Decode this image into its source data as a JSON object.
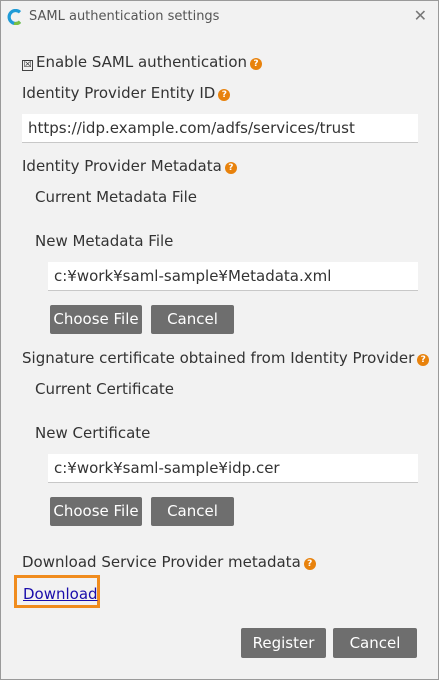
{
  "window": {
    "title": "SAML authentication settings",
    "app_icon": "app-logo-icon",
    "close_icon": "close-icon"
  },
  "enable": {
    "label": "Enable SAML authentication",
    "checked": true
  },
  "help_glyph": "?",
  "entity_id": {
    "label": "Identity Provider Entity ID",
    "value": "https://idp.example.com/adfs/services/trust"
  },
  "metadata": {
    "label": "Identity Provider Metadata",
    "current_label": "Current Metadata File",
    "new_label": "New Metadata File",
    "file_value": "c:¥work¥saml-sample¥Metadata.xml",
    "choose_label": "Choose File",
    "cancel_label": "Cancel"
  },
  "certificate": {
    "label": "Signature certificate obtained from Identity Provider",
    "current_label": "Current Certificate",
    "new_label": "New Certificate",
    "file_value": "c:¥work¥saml-sample¥idp.cer",
    "choose_label": "Choose File",
    "cancel_label": "Cancel"
  },
  "sp_metadata": {
    "label": "Download Service Provider metadata",
    "download_label": "Download"
  },
  "footer": {
    "register_label": "Register",
    "cancel_label": "Cancel"
  },
  "colors": {
    "accent": "#e8820c",
    "button": "#6e6e6e",
    "link": "#1a0dab",
    "highlight": "#f08c1e"
  }
}
